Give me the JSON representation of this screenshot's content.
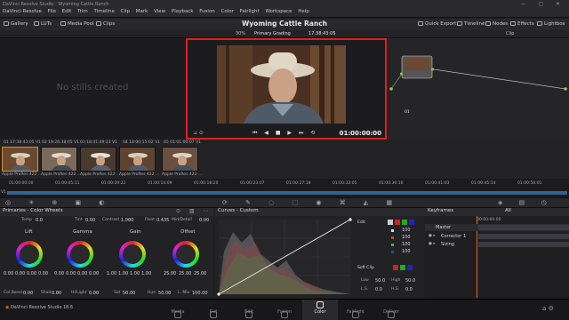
{
  "window": {
    "title": "DaVinci Resolve Studio - Wyoming Cattle Ranch",
    "menu": [
      "DaVinci Resolve",
      "File",
      "Edit",
      "Trim",
      "Timeline",
      "Clip",
      "Mark",
      "View",
      "Playback",
      "Fusion",
      "Color",
      "Fairlight",
      "Workspace",
      "Help"
    ]
  },
  "project_title": "Wyoming Cattle Ranch",
  "toolbar": {
    "gallery": "Gallery",
    "luts": "LUTs",
    "media_pool": "Media Pool",
    "clips": "Clips",
    "quick_export": "Quick Export",
    "timeline": "Timeline",
    "nodes": "Nodes",
    "effects": "Effects",
    "lightbox": "Lightbox"
  },
  "viewer_bar": {
    "zoom": "30%",
    "grade": "Primary Grading",
    "timecode": "17:38:43:05",
    "clip": "Clip"
  },
  "gallery": {
    "empty_text": "No stills created"
  },
  "viewer": {
    "timecode": "01:00:00:00"
  },
  "nodes": {
    "node_label": "01"
  },
  "clips": [
    {
      "index": "01",
      "tc": "17:38:43:05",
      "track": "V1",
      "label": "Apple ProRes 422 ..."
    },
    {
      "index": "02",
      "tc": "19:26:38:05",
      "track": "V1",
      "label": "Apple ProRes 422 ..."
    },
    {
      "index": "03",
      "tc": "18:41:49:23",
      "track": "V1",
      "label": "Apple ProRes 422 ..."
    },
    {
      "index": "04",
      "tc": "18:00:15:02",
      "track": "V1",
      "label": "Apple ProRes 422 ..."
    },
    {
      "index": "05",
      "tc": "01:01:00:07",
      "track": "V1",
      "label": "Apple ProRes 422 ..."
    }
  ],
  "timeline_ruler": [
    "01:00:00:00",
    "01:00:05:11",
    "01:00:09:22",
    "01:00:14:09",
    "01:00:18:20",
    "01:00:23:07",
    "01:00:27:18",
    "01:00:32:05",
    "01:00:36:16",
    "01:00:41:03",
    "01:00:45:14",
    "01:00:50:01"
  ],
  "primaries": {
    "title": "Primaries - Color Wheels",
    "temp_label": "Temp",
    "temp": "0.0",
    "tint_label": "Tint",
    "tint": "0.00",
    "contrast_label": "Contrast",
    "contrast": "1.000",
    "pivot_label": "Pivot",
    "pivot": "0.435",
    "middetail_label": "Mid/Detail",
    "middetail": "0.00",
    "wheels": [
      {
        "name": "Lift",
        "values": [
          "0.00",
          "0.00",
          "0.00",
          "0.00"
        ]
      },
      {
        "name": "Gamma",
        "values": [
          "0.00",
          "0.00",
          "0.00",
          "0.00"
        ]
      },
      {
        "name": "Gain",
        "values": [
          "1.00",
          "1.00",
          "1.00",
          "1.00"
        ]
      },
      {
        "name": "Offset",
        "values": [
          "25.00",
          "25.00",
          "25.00"
        ]
      }
    ],
    "colboost_label": "Col Boost",
    "colboost": "0.00",
    "shad_label": "Shad",
    "shad": "0.00",
    "hilight_label": "Hi/Light",
    "hilight": "0.00",
    "sat_label": "Sat",
    "sat": "50.00",
    "hue_label": "Hue",
    "hue": "50.00",
    "lmix_label": "L. Mix",
    "lmix": "100.00"
  },
  "curves": {
    "title": "Curves - Custom"
  },
  "rgb": {
    "edit_label": "Edit",
    "values": [
      "100",
      "100",
      "100",
      "100"
    ],
    "softclip_label": "Soft Clip",
    "low_label": "Low",
    "low": "50.0",
    "high_label": "High",
    "high": "50.0",
    "ls_label": "L.S.",
    "ls": "0.0",
    "hs_label": "H.S.",
    "hs": "0.0"
  },
  "keyframes": {
    "title": "Keyframes",
    "filter": "All",
    "timecode": "00:00:00:00",
    "rows": [
      "Master",
      "Corrector 1",
      "Sizing"
    ]
  },
  "bottom_nav": {
    "app_name": "DaVinci Resolve Studio 18.6",
    "items": [
      "Media",
      "Cut",
      "Edit",
      "Fusion",
      "Color",
      "Fairlight",
      "Deliver"
    ],
    "active": "Color"
  },
  "colors": {
    "accent_red": "#e02020",
    "playhead": "#e06a20",
    "timeline_blue": "#35618f"
  }
}
